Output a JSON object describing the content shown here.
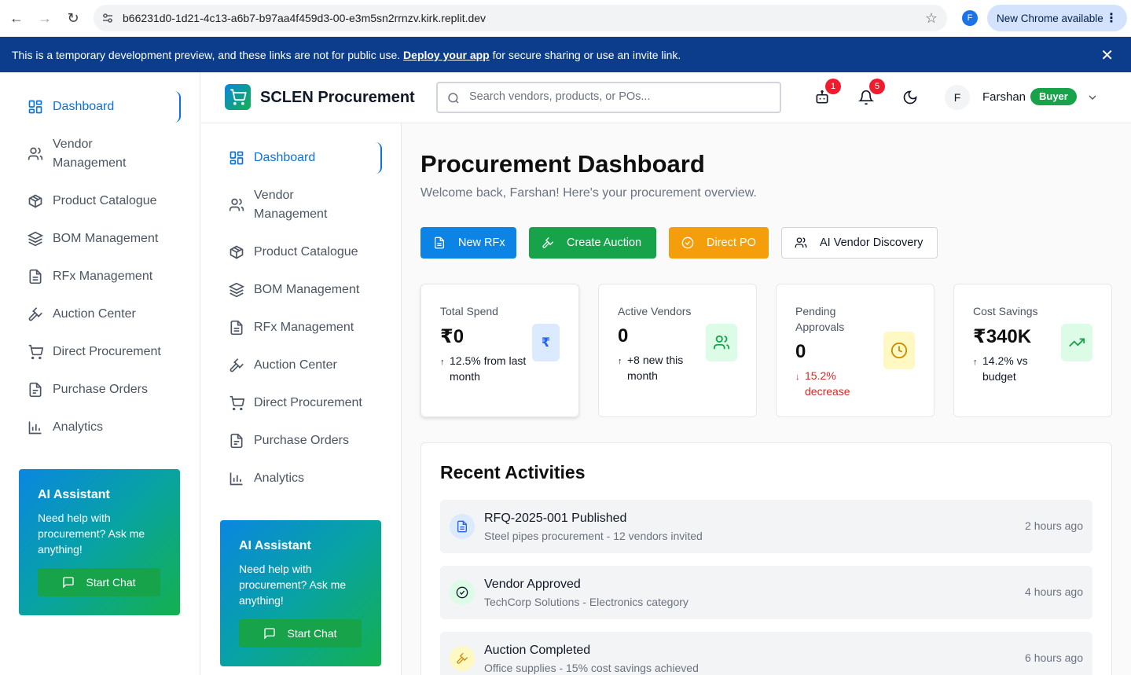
{
  "browser": {
    "url": "b66231d0-1d21-4c13-a6b7-b97aa4f459d3-00-e3m5sn2rrnzv.kirk.replit.dev",
    "profile_initial": "F",
    "update_label": "New Chrome available"
  },
  "banner": {
    "text_before": "This is a temporary development preview, and these links are not for public use. ",
    "link": "Deploy your app",
    "text_after": " for secure sharing or use an invite link."
  },
  "sidebar": {
    "items": [
      {
        "label": "Dashboard",
        "icon": "grid-icon"
      },
      {
        "label": "Vendor Management",
        "icon": "users-icon"
      },
      {
        "label": "Product Catalogue",
        "icon": "package-icon"
      },
      {
        "label": "BOM Management",
        "icon": "layers-icon"
      },
      {
        "label": "RFx Management",
        "icon": "file-text-icon"
      },
      {
        "label": "Auction Center",
        "icon": "gavel-icon"
      },
      {
        "label": "Direct Procurement",
        "icon": "cart-icon"
      },
      {
        "label": "Purchase Orders",
        "icon": "file-icon"
      },
      {
        "label": "Analytics",
        "icon": "bar-chart-icon"
      }
    ],
    "ai": {
      "title": "AI Assistant",
      "text": "Need help with procurement? Ask me anything!",
      "button": "Start Chat"
    }
  },
  "header": {
    "brand": "SCLEN Procurement",
    "search_placeholder": "Search vendors, products, or POs...",
    "bot_badge": "1",
    "bell_badge": "5",
    "user_initial": "F",
    "user_name": "Farshan",
    "user_role": "Buyer"
  },
  "main": {
    "title": "Procurement Dashboard",
    "subtitle": "Welcome back, Farshan! Here's your procurement overview.",
    "actions": [
      "New RFx",
      "Create Auction",
      "Direct PO",
      "AI Vendor Discovery"
    ],
    "stats": [
      {
        "label": "Total Spend",
        "value": "₹0",
        "change": "12.5% from last month",
        "trend": "up",
        "icon_text": "₹"
      },
      {
        "label": "Active Vendors",
        "value": "0",
        "change": "+8 new this month",
        "trend": "up"
      },
      {
        "label": "Pending Approvals",
        "value": "0",
        "change": "15.2% decrease",
        "trend": "down"
      },
      {
        "label": "Cost Savings",
        "value": "₹340K",
        "change": "14.2% vs budget",
        "trend": "up"
      }
    ],
    "activities_title": "Recent Activities",
    "activities": [
      {
        "title": "RFQ-2025-001 Published",
        "desc": "Steel pipes procurement - 12 vendors invited",
        "time": "2 hours ago"
      },
      {
        "title": "Vendor Approved",
        "desc": "TechCorp Solutions - Electronics category",
        "time": "4 hours ago"
      },
      {
        "title": "Auction Completed",
        "desc": "Office supplies - 15% cost savings achieved",
        "time": "6 hours ago"
      }
    ]
  },
  "colors": {
    "primary": "#0b72d9",
    "green": "#16a34a",
    "orange": "#f59e0b",
    "banner": "#0b3d8c",
    "danger": "#dc2626"
  }
}
